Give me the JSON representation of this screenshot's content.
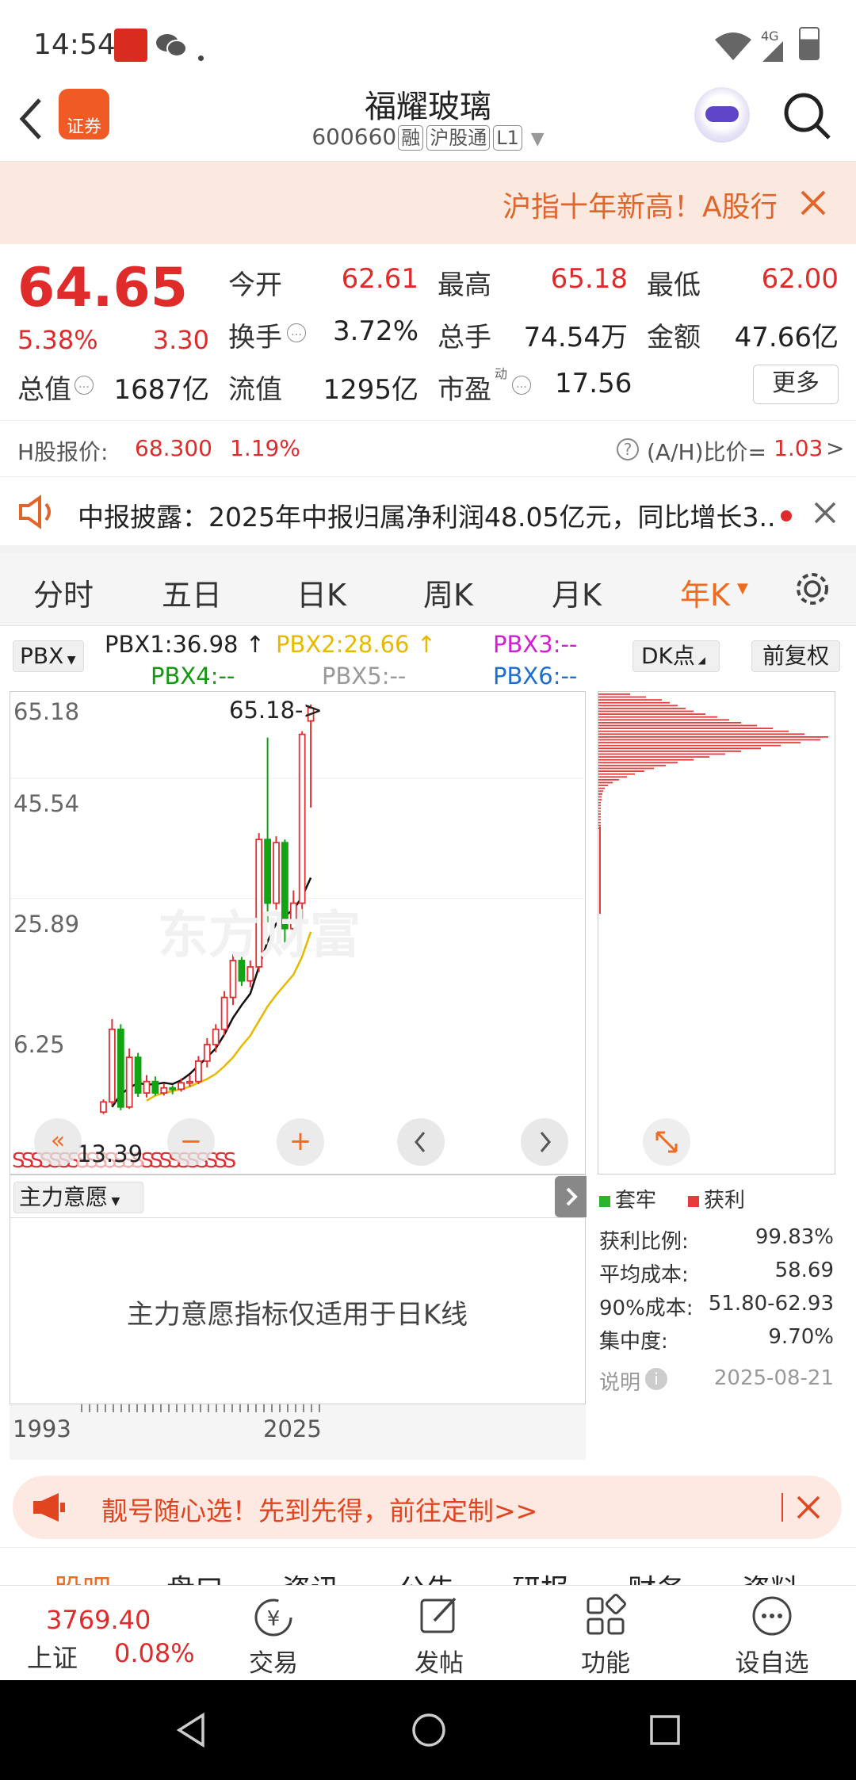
{
  "status_bar": {
    "time": "14:54",
    "network": "4G"
  },
  "header": {
    "back_icon": "chevron-left-icon",
    "app_badge": "证券",
    "title": "福耀玻璃",
    "code": "600660",
    "tags": [
      "融",
      "沪股通",
      "L1"
    ],
    "search_icon": "search-icon"
  },
  "banner": {
    "text": "沪指十年新高！A股行"
  },
  "quote": {
    "price": "64.65",
    "change_pct": "5.38%",
    "change": "3.30",
    "open_label": "今开",
    "open": "62.61",
    "high_label": "最高",
    "high": "65.18",
    "low_label": "最低",
    "low": "62.00",
    "turnover_label": "换手",
    "turnover": "3.72%",
    "volume_label": "总手",
    "volume": "74.54万",
    "amount_label": "金额",
    "amount": "47.66亿",
    "mktcap_label": "总值",
    "mktcap": "1687亿",
    "float_label": "流值",
    "float": "1295亿",
    "pe_label": "市盈",
    "pe_sup": "动",
    "pe": "17.56",
    "more_label": "更多"
  },
  "h_share": {
    "label": "H股报价:",
    "price": "68.300",
    "pct": "1.19%",
    "ratio_label": "(A/H)比价=",
    "ratio": "1.03",
    "arrow": ">"
  },
  "notice": {
    "text": "中报披露：2025年中报归属净利润48.05亿元，同比增长3.."
  },
  "tabs": [
    "分时",
    "五日",
    "日K",
    "周K",
    "月K",
    "年K"
  ],
  "active_tab": "年K",
  "indicators": {
    "selector": "PBX",
    "pbx1": "PBX1:36.98",
    "pbx2": "PBX2:28.66",
    "pbx3": "PBX3:--",
    "pbx4": "PBX4:--",
    "pbx5": "PBX5:--",
    "pbx6": "PBX6:--",
    "dk": "DK点",
    "adjust": "前复权"
  },
  "chart": {
    "y_labels": [
      "65.18",
      "45.54",
      "25.89",
      "6.25"
    ],
    "max_annot": "65.18->",
    "min_annot": "13.39",
    "watermark": "东方财富"
  },
  "chart_data": {
    "type": "candlestick",
    "title": "",
    "x_range": [
      "1993",
      "2025"
    ],
    "ylim": [
      0,
      65.18
    ],
    "candles": [
      {
        "open": 1.2,
        "close": 2.8,
        "high": 3.2,
        "low": 0.9,
        "up": true
      },
      {
        "open": 2.8,
        "close": 14.2,
        "high": 15.8,
        "low": 2.2,
        "up": true
      },
      {
        "open": 14.2,
        "close": 2.0,
        "high": 15.0,
        "low": 1.5,
        "up": false
      },
      {
        "open": 2.0,
        "close": 9.8,
        "high": 11.2,
        "low": 1.7,
        "up": true
      },
      {
        "open": 9.8,
        "close": 4.2,
        "high": 10.5,
        "low": 3.6,
        "up": false
      },
      {
        "open": 4.2,
        "close": 6.0,
        "high": 7.0,
        "low": 3.5,
        "up": true
      },
      {
        "open": 6.0,
        "close": 4.2,
        "high": 6.8,
        "low": 3.8,
        "up": false
      },
      {
        "open": 4.2,
        "close": 5.0,
        "high": 5.6,
        "low": 3.8,
        "up": true
      },
      {
        "open": 5.0,
        "close": 4.8,
        "high": 5.4,
        "low": 4.0,
        "up": false
      },
      {
        "open": 4.8,
        "close": 5.8,
        "high": 6.5,
        "low": 4.4,
        "up": true
      },
      {
        "open": 5.8,
        "close": 6.0,
        "high": 7.0,
        "low": 5.2,
        "up": true
      },
      {
        "open": 6.0,
        "close": 9.2,
        "high": 10.0,
        "low": 5.6,
        "up": true
      },
      {
        "open": 9.2,
        "close": 11.8,
        "high": 12.8,
        "low": 8.2,
        "up": true
      },
      {
        "open": 11.8,
        "close": 14.2,
        "high": 15.0,
        "low": 10.6,
        "up": true
      },
      {
        "open": 14.2,
        "close": 19.2,
        "high": 20.2,
        "low": 13.2,
        "up": true
      },
      {
        "open": 19.2,
        "close": 25.0,
        "high": 26.0,
        "low": 18.0,
        "up": true
      },
      {
        "open": 25.0,
        "close": 21.8,
        "high": 26.2,
        "low": 21.0,
        "up": false
      },
      {
        "open": 21.8,
        "close": 24.0,
        "high": 25.0,
        "low": 20.8,
        "up": true
      },
      {
        "open": 24.0,
        "close": 44.0,
        "high": 45.0,
        "low": 23.2,
        "up": true
      },
      {
        "open": 44.0,
        "close": 34.0,
        "high": 60.0,
        "low": 31.0,
        "up": false
      },
      {
        "open": 34.0,
        "close": 43.5,
        "high": 44.5,
        "low": 33.0,
        "up": true
      },
      {
        "open": 43.5,
        "close": 30.0,
        "high": 44.0,
        "low": 27.5,
        "up": false
      },
      {
        "open": 30.0,
        "close": 34.0,
        "high": 36.0,
        "low": 28.5,
        "up": true
      },
      {
        "open": 34.0,
        "close": 60.5,
        "high": 61.0,
        "low": 31.0,
        "up": true
      },
      {
        "open": 62.61,
        "close": 64.65,
        "high": 65.18,
        "low": 49.0,
        "up": true
      }
    ],
    "ma_black": [
      null,
      2.0,
      4.0,
      5.0,
      5.8,
      5.5,
      5.6,
      5.8,
      5.6,
      6.2,
      7.2,
      8.5,
      9.8,
      11.2,
      13.4,
      16.0,
      18.0,
      19.8,
      24.0,
      28.0,
      30.8,
      32.0,
      33.0,
      35.0,
      38.0
    ],
    "ma_yellow": [
      null,
      null,
      null,
      null,
      null,
      3.0,
      3.8,
      4.2,
      4.5,
      4.8,
      5.2,
      5.8,
      6.4,
      7.2,
      8.4,
      9.8,
      11.6,
      13.2,
      15.5,
      17.8,
      19.6,
      21.2,
      22.8,
      25.6,
      29.5
    ]
  },
  "chart_nav": {
    "left_icon": "chevron-left-icon",
    "right_icon": "chevron-right-icon"
  },
  "chip": {
    "legend_trapped": "套牢",
    "legend_profit": "获利",
    "rows": [
      {
        "label": "获利比例:",
        "value": "99.83%"
      },
      {
        "label": "平均成本:",
        "value": "58.69"
      },
      {
        "label": "90%成本:",
        "value": "51.80-62.93"
      },
      {
        "label": "集中度:",
        "value": "9.70%"
      }
    ],
    "note_label": "说明",
    "date": "2025-08-21"
  },
  "sub_indicator": {
    "selector": "主力意愿",
    "message": "主力意愿指标仅适用于日K线"
  },
  "x_axis": {
    "start": "1993",
    "end": "2025"
  },
  "ad": {
    "text": "靓号随心选！先到先得，前往定制>>"
  },
  "bottom_tabs": [
    "股吧",
    "盘口",
    "资讯",
    "公告",
    "研报",
    "财务",
    "资料"
  ],
  "index": {
    "value": "3769.40",
    "name": "上证",
    "pct": "0.08%"
  },
  "nav": [
    {
      "label": "交易",
      "icon": "yen-exchange-icon"
    },
    {
      "label": "发帖",
      "icon": "edit-icon"
    },
    {
      "label": "功能",
      "icon": "grid-icon"
    },
    {
      "label": "设自选",
      "icon": "more-icon"
    }
  ]
}
